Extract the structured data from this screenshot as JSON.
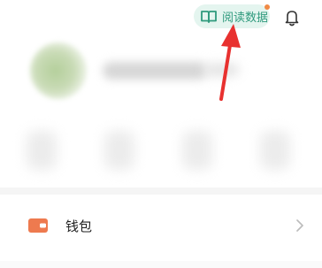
{
  "header": {
    "reading_data_label": "阅读数据",
    "book_icon": "book-icon",
    "bell_icon": "bell-icon",
    "has_notification_dot": true
  },
  "menu": {
    "wallet_label": "钱包",
    "wallet_icon": "wallet-icon",
    "chevron_icon": "chevron-right-icon"
  },
  "colors": {
    "accent": "#2f9a7d",
    "accent_bg": "#e4f5ef",
    "badge": "#f08a45",
    "arrow": "#e8312f",
    "wallet_icon": "#ee7a4f"
  }
}
